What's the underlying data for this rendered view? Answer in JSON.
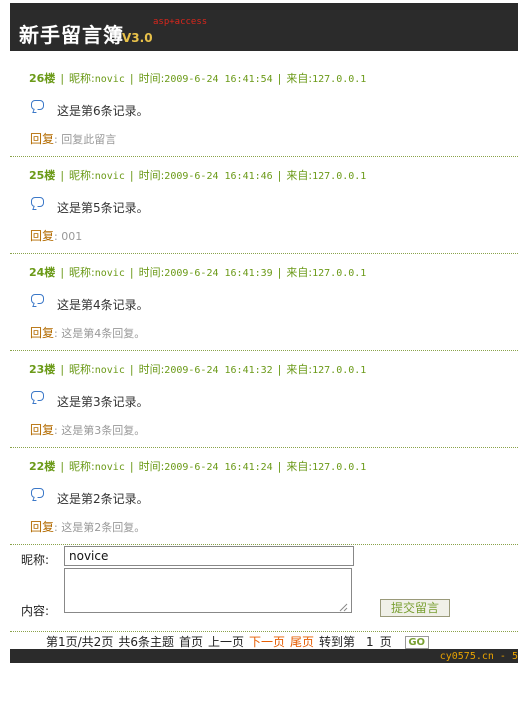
{
  "header": {
    "logo": "新手留言簿",
    "version": "V3.0",
    "tagline": "asp+access"
  },
  "posts": [
    {
      "floor": "26楼",
      "nick_label": "昵称:",
      "nick": "novic",
      "time_label": "时间:",
      "time": "2009-6-24 16:41:54",
      "from_label": "来自:",
      "ip": "127.0.0.1",
      "content": "这是第6条记录。",
      "reply_label": "回复",
      "reply": ": 回复此留言"
    },
    {
      "floor": "25楼",
      "nick_label": "昵称:",
      "nick": "novic",
      "time_label": "时间:",
      "time": "2009-6-24 16:41:46",
      "from_label": "来自:",
      "ip": "127.0.0.1",
      "content": "这是第5条记录。",
      "reply_label": "回复",
      "reply": ": 001"
    },
    {
      "floor": "24楼",
      "nick_label": "昵称:",
      "nick": "novic",
      "time_label": "时间:",
      "time": "2009-6-24 16:41:39",
      "from_label": "来自:",
      "ip": "127.0.0.1",
      "content": "这是第4条记录。",
      "reply_label": "回复",
      "reply": ": 这是第4条回复。"
    },
    {
      "floor": "23楼",
      "nick_label": "昵称:",
      "nick": "novic",
      "time_label": "时间:",
      "time": "2009-6-24 16:41:32",
      "from_label": "来自:",
      "ip": "127.0.0.1",
      "content": "这是第3条记录。",
      "reply_label": "回复",
      "reply": ": 这是第3条回复。"
    },
    {
      "floor": "22楼",
      "nick_label": "昵称:",
      "nick": "novic",
      "time_label": "时间:",
      "time": "2009-6-24 16:41:24",
      "from_label": "来自:",
      "ip": "127.0.0.1",
      "content": "这是第2条记录。",
      "reply_label": "回复",
      "reply": ": 这是第2条回复。"
    }
  ],
  "form": {
    "nick_label": "昵称:",
    "nick_value": "novice",
    "content_label": "内容:",
    "submit_label": "提交留言"
  },
  "pager": {
    "page_info": "第1页/共2页",
    "total": "共6条主题",
    "first": "首页",
    "prev": "上一页",
    "next": "下一页",
    "last": "尾页",
    "goto_label": "转到第",
    "goto_value": "1",
    "page_suffix": "页",
    "go_label": "GO"
  },
  "footer": {
    "text": "cy0575.cn - 5"
  },
  "colors": {
    "meta": "#6b9a18",
    "reply_label": "#b36b00",
    "link_red": "#e65c00",
    "header_bg": "#2b2b2b"
  },
  "icons": {
    "post": "comment-bubble-icon"
  }
}
